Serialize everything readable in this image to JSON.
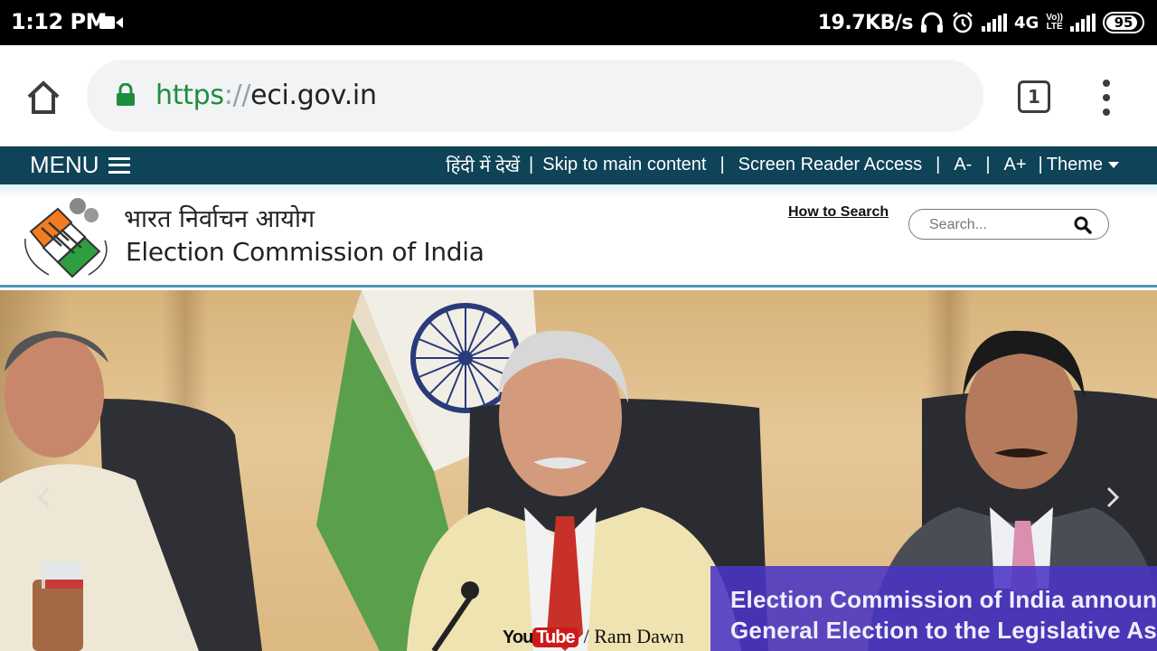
{
  "status_bar": {
    "time": "1:12 PM",
    "net_speed": "19.7KB/s",
    "network_type": "4G",
    "volte_top": "Vo))",
    "volte_bottom": "LTE",
    "battery": "95"
  },
  "browser": {
    "url_scheme": "https",
    "url_separator": "://",
    "url_host": "eci.gov.in",
    "tab_count": "1"
  },
  "nav": {
    "menu_label": "MENU",
    "links": {
      "hindi": "हिंदी में देखें",
      "skip": "Skip to main content",
      "screen_reader": "Screen Reader Access",
      "font_decrease": "A-",
      "font_increase": "A+",
      "theme": "Theme"
    },
    "pipe": "|"
  },
  "header": {
    "org_name_hindi": "भारत निर्वाचन आयोग",
    "org_name_english": "Election Commission of India",
    "how_to_search": "How to Search",
    "search_placeholder": "Search..."
  },
  "banner": {
    "announcement_line1": "Election Commission of India announc",
    "announcement_line2": "General Election to the Legislative Ass",
    "watermark_you": "You",
    "watermark_tube": "Tube",
    "watermark_channel": "/ Ram Dawn"
  },
  "colors": {
    "status_bar": "#000000",
    "nav_bar": "#0e4358",
    "url_scheme": "#1e8e3e",
    "announcement_bg": "#4a34c4"
  }
}
